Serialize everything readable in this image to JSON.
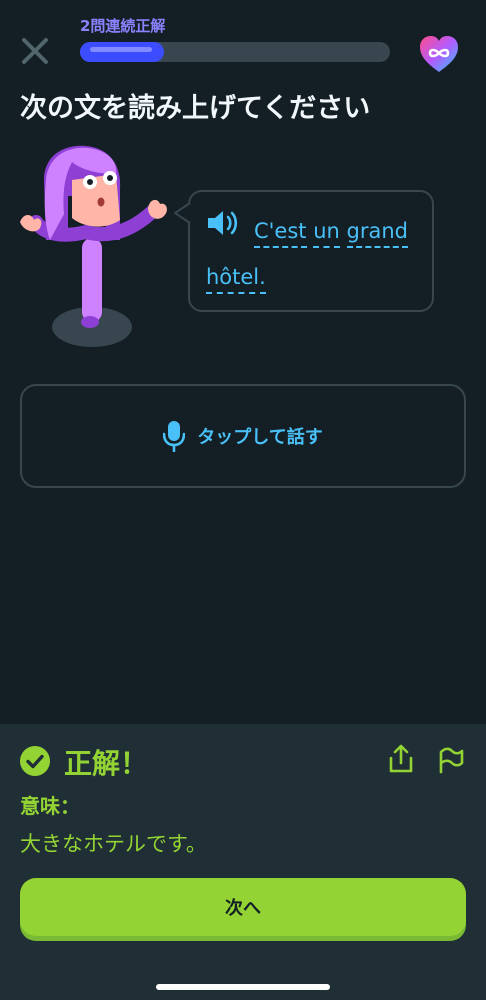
{
  "header": {
    "close_icon": "close-icon",
    "streak_label": "2問連続正解",
    "progress": 0.27,
    "hearts_icon": "infinite-heart-icon"
  },
  "prompt": {
    "title": "次の文を読み上げてください"
  },
  "speech_bubble": {
    "speaker_icon": "speaker-icon",
    "words": [
      "C'est",
      "un",
      "grand",
      "hôtel."
    ]
  },
  "mic": {
    "icon": "microphone-icon",
    "label": "タップして話す"
  },
  "result": {
    "icon": "check-circle-icon",
    "title": "正解！",
    "meaning_label": "意味：",
    "meaning_text": "大きなホテルです。",
    "share_icon": "share-icon",
    "report_icon": "flag-icon",
    "next_label": "次へ"
  },
  "colors": {
    "background": "#131f24",
    "panel": "#202f36",
    "accent_blue": "#49c0f8",
    "progress": "#3c4dff",
    "success_green": "#93d333",
    "border": "#37464f"
  }
}
